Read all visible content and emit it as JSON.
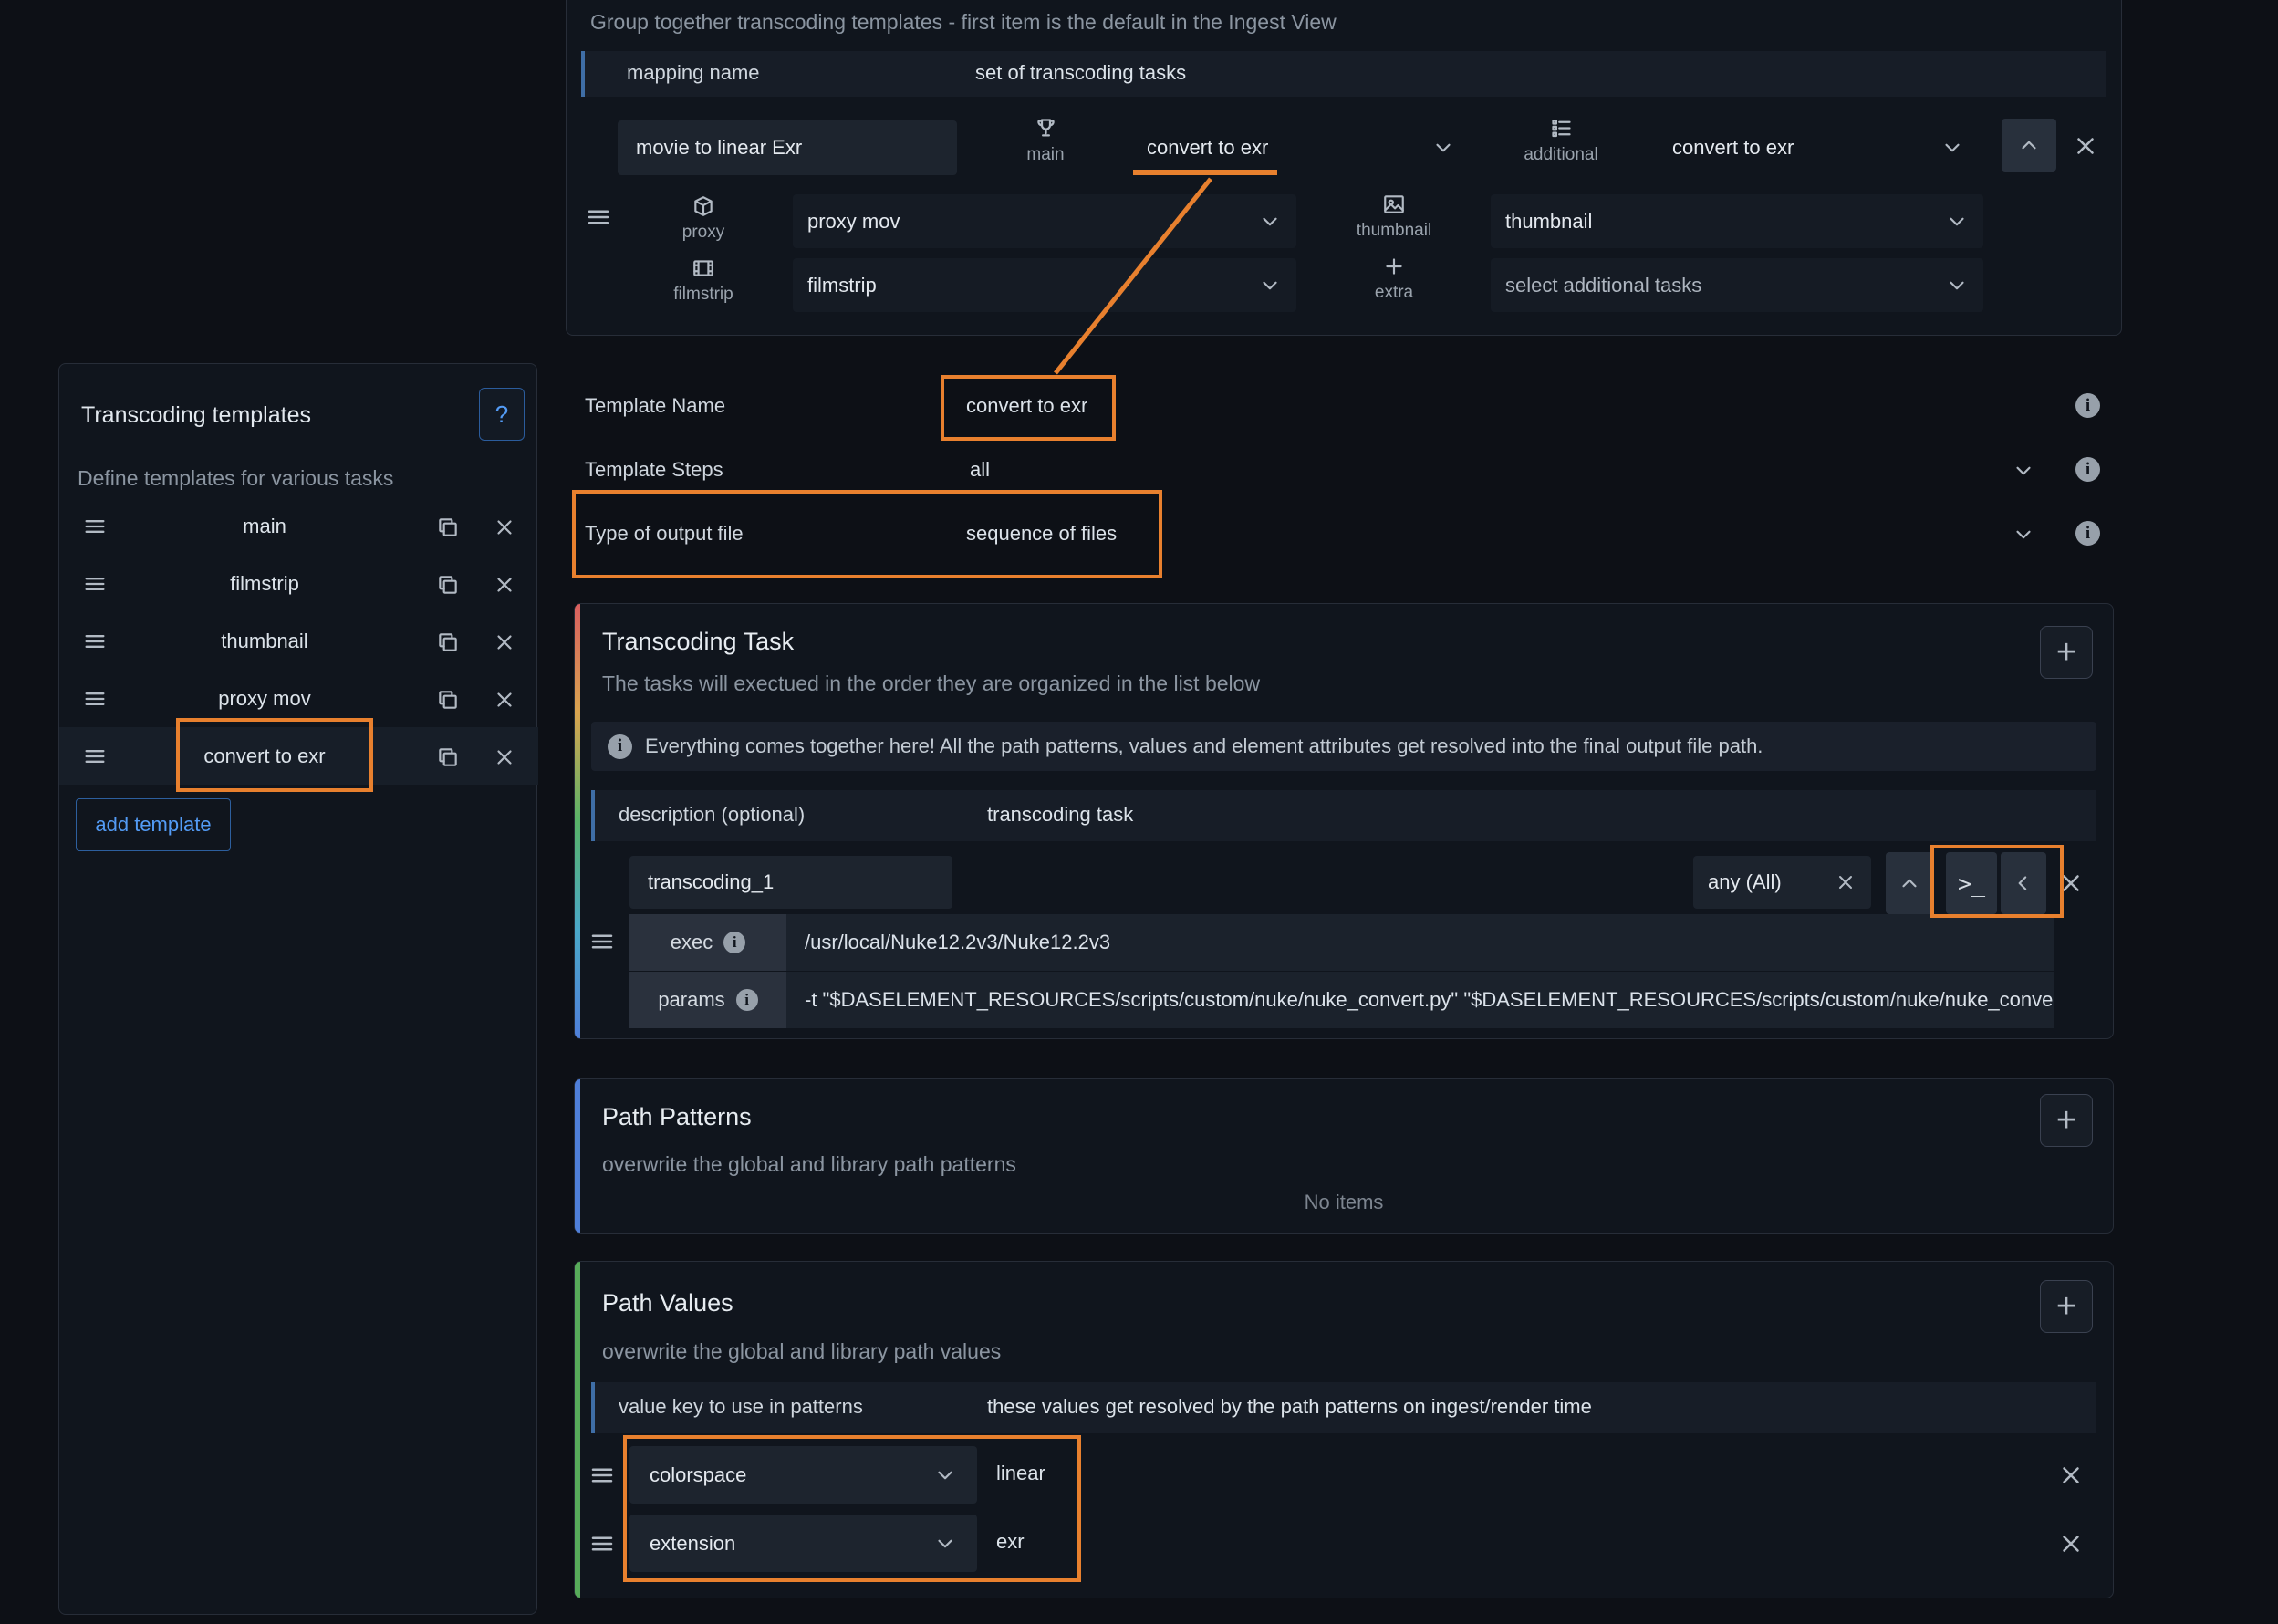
{
  "theme": {
    "page_bg": "#0d1016",
    "panel_bg": "#10151d",
    "accent_blue": "#539bf5",
    "accent_bar_blue": "#3f6ea6",
    "annotation_orange": "#e8802e",
    "path_values_stripe": "#57ab5a",
    "path_patterns_stripe": "#4f7fd9"
  },
  "icons": {
    "help": "?",
    "terminal": ">_",
    "plus": "+"
  },
  "top_panel": {
    "hint": "Group together transcoding templates - first item is the default in the Ingest View",
    "mapping": {
      "label": "mapping name",
      "value": "set of transcoding tasks"
    },
    "template": {
      "name": "movie to linear Exr",
      "main": {
        "label": "main",
        "value": "convert to exr"
      },
      "additional": {
        "label": "additional",
        "value": "convert to exr"
      },
      "proxy": {
        "label": "proxy",
        "value": "proxy mov"
      },
      "thumbnail": {
        "label": "thumbnail",
        "value": "thumbnail"
      },
      "filmstrip": {
        "label": "filmstrip",
        "value": "filmstrip"
      },
      "extra": {
        "label": "extra",
        "value": "select additional tasks"
      }
    }
  },
  "sidebar": {
    "title": "Transcoding templates",
    "help_button": "?",
    "subtitle": "Define templates for various tasks",
    "items": [
      {
        "label": "main"
      },
      {
        "label": "filmstrip"
      },
      {
        "label": "thumbnail"
      },
      {
        "label": "proxy mov"
      },
      {
        "label": "convert to exr"
      }
    ],
    "add_button": "add template"
  },
  "main": {
    "template_name": {
      "label": "Template Name",
      "value": "convert to exr"
    },
    "template_steps": {
      "label": "Template Steps",
      "value": "all"
    },
    "output_type": {
      "label": "Type of output file",
      "value": "sequence of files"
    },
    "task_section": {
      "title": "Transcoding Task",
      "subtitle": "The tasks will exectued in the order they are organized in the list below",
      "info": "Everything comes together here! All the path patterns, values and element attributes get resolved into the final output file path.",
      "description": {
        "label": "description (optional)",
        "value": "transcoding task"
      },
      "task": {
        "name": "transcoding_1",
        "scope": "any (All)",
        "exec_label": "exec",
        "exec_value": "/usr/local/Nuke12.2v3/Nuke12.2v3",
        "params_label": "params",
        "params_value": "-t \"$DASELEMENT_RESOURCES/scripts/custom/nuke/nuke_convert.py\" \"$DASELEMENT_RESOURCES/scripts/custom/nuke/nuke_convert_lin"
      }
    },
    "path_patterns": {
      "title": "Path Patterns",
      "subtitle": "overwrite the global and library path patterns",
      "empty": "No items"
    },
    "path_values": {
      "title": "Path Values",
      "subtitle": "overwrite the global and library path values",
      "header": {
        "key": "value key to use in patterns",
        "desc": "these values get resolved by the path patterns on ingest/render time"
      },
      "rows": [
        {
          "key": "colorspace",
          "value": "linear"
        },
        {
          "key": "extension",
          "value": "exr"
        }
      ]
    }
  }
}
